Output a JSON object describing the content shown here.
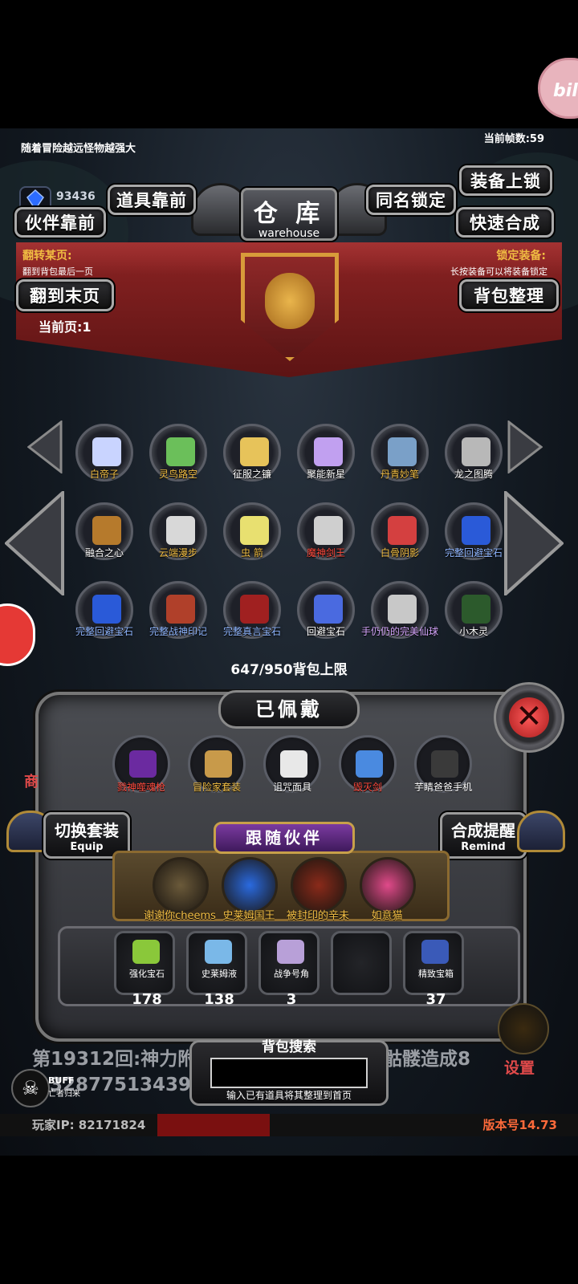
{
  "hud": {
    "message": "随着冒险越远怪物越强大",
    "fps": "当前帧数:59",
    "gem_count": "93436",
    "bili_badge": "bili"
  },
  "warehouse": {
    "title_cn": "仓 库",
    "title_en": "warehouse"
  },
  "buttons": {
    "items_front": "道具靠前",
    "partner_front": "伙伴靠前",
    "same_name_lock": "同名锁定",
    "equip_lock": "装备上锁",
    "quick_synth": "快速合成",
    "to_last_page": "翻到末页",
    "bag_sort": "背包整理"
  },
  "info": {
    "flip_title": "翻转某页:",
    "flip_desc": "翻到背包最后一页",
    "lock_title": "锁定装备:",
    "lock_desc": "长按装备可以将装备锁定",
    "current_page": "当前页:1"
  },
  "grid": [
    {
      "name": "白帝子",
      "color": "gold",
      "icon": "#c9d4ff"
    },
    {
      "name": "灵鸟路空",
      "color": "gold",
      "icon": "#6bbf5a"
    },
    {
      "name": "征服之镰",
      "color": "white",
      "icon": "#e7c35a"
    },
    {
      "name": "聚能新星",
      "color": "white",
      "icon": "#c1a0f0"
    },
    {
      "name": "丹青妙笔",
      "color": "gold",
      "icon": "#7aa0c8"
    },
    {
      "name": "龙之图腾",
      "color": "white",
      "icon": "#b8b8b8"
    },
    {
      "name": "融合之心",
      "color": "white",
      "icon": "#b67a2c"
    },
    {
      "name": "云端漫步",
      "color": "gold",
      "icon": "#d8d8d8"
    },
    {
      "name": "虫 箭",
      "color": "gold",
      "icon": "#e8e070"
    },
    {
      "name": "魔神剑王",
      "color": "red",
      "icon": "#cfcfcf"
    },
    {
      "name": "白骨阴影",
      "color": "gold",
      "icon": "#d44040"
    },
    {
      "name": "完整回避宝石",
      "color": "blue",
      "icon": "#2a5ad8"
    },
    {
      "name": "完整回避宝石",
      "color": "blue",
      "icon": "#2a5ad8"
    },
    {
      "name": "完整战神印记",
      "color": "blue",
      "icon": "#b0402a"
    },
    {
      "name": "完整真言宝石",
      "color": "blue",
      "icon": "#a02020"
    },
    {
      "name": "回避宝石",
      "color": "white",
      "icon": "#4a6ae0"
    },
    {
      "name": "手仍仍的完美仙球",
      "color": "purple",
      "icon": "#c8c8c8"
    },
    {
      "name": "小木灵",
      "color": "white",
      "icon": "#2c5a2c"
    }
  ],
  "capacity": "647/950背包上限",
  "equipped": {
    "title": "已佩戴",
    "items": [
      {
        "name": "戮神噬魂枪",
        "color": "red",
        "icon": "#6b2aa0"
      },
      {
        "name": "冒险家套装",
        "color": "gold",
        "icon": "#c89a4a"
      },
      {
        "name": "诅咒面具",
        "color": "white",
        "icon": "#e8e8e8"
      },
      {
        "name": "毁灭剑",
        "color": "red",
        "icon": "#4a8ae0"
      },
      {
        "name": "芋睛爸爸手机",
        "color": "white",
        "icon": "#3a3a3a"
      }
    ]
  },
  "switch_suit": {
    "cn": "切换套装",
    "en": "Equip"
  },
  "synth_remind": {
    "cn": "合成提醒",
    "en": "Remind"
  },
  "partners": {
    "title": "跟随伙伴",
    "items": [
      {
        "name": "谢谢你cheems",
        "color": "#6b5a3a"
      },
      {
        "name": "史莱姆国王",
        "color": "#2a6ae0"
      },
      {
        "name": "被封印的辛未",
        "color": "#8a2a1a"
      },
      {
        "name": "如意猫",
        "color": "#e04a8a"
      }
    ]
  },
  "materials": [
    {
      "name": "强化宝石",
      "count": "178",
      "icon": "#8ac83a"
    },
    {
      "name": "史莱姆液",
      "count": "138",
      "icon": "#7ab8e8"
    },
    {
      "name": "战争号角",
      "count": "3",
      "icon": "#b8a0d8"
    },
    {
      "name": "",
      "count": "",
      "icon": "#555"
    },
    {
      "name": "精致宝箱",
      "count": "37",
      "icon": "#3a5ab8"
    }
  ],
  "log": {
    "line1_left": "第19312回:神力附",
    "line1_right": "骷髅造成8",
    "line2": "32877513439点"
  },
  "search": {
    "label": "背包搜索",
    "placeholder": "",
    "hint": "输入已有道具将其整理到首页"
  },
  "footer": {
    "ip": "玩家IP:  82171824",
    "version": "版本号14.73",
    "buff": "BUFF",
    "buff_sub": "亡者归来",
    "settings": "设置",
    "shop": "商"
  }
}
